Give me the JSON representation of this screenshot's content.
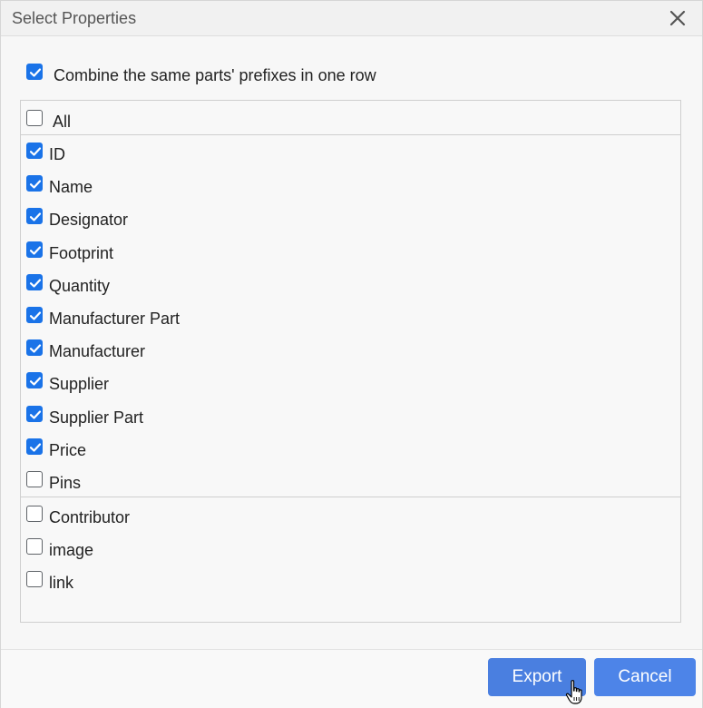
{
  "dialog": {
    "title": "Select Properties",
    "close_icon": "close-icon",
    "combine": {
      "label": "Combine the same parts' prefixes in one row",
      "checked": true
    },
    "all": {
      "label": "All",
      "checked": false
    },
    "group1": [
      {
        "key": "id",
        "label": "ID",
        "checked": true
      },
      {
        "key": "name",
        "label": "Name",
        "checked": true
      },
      {
        "key": "designator",
        "label": "Designator",
        "checked": true
      },
      {
        "key": "footprint",
        "label": "Footprint",
        "checked": true
      },
      {
        "key": "quantity",
        "label": "Quantity",
        "checked": true
      },
      {
        "key": "manufacturer-part",
        "label": "Manufacturer Part",
        "checked": true
      },
      {
        "key": "manufacturer",
        "label": "Manufacturer",
        "checked": true
      },
      {
        "key": "supplier",
        "label": "Supplier",
        "checked": true
      },
      {
        "key": "supplier-part",
        "label": "Supplier Part",
        "checked": true
      },
      {
        "key": "price",
        "label": "Price",
        "checked": true
      },
      {
        "key": "pins",
        "label": "Pins",
        "checked": false
      }
    ],
    "group2": [
      {
        "key": "contributor",
        "label": "Contributor",
        "checked": false
      },
      {
        "key": "image",
        "label": "image",
        "checked": false
      },
      {
        "key": "link",
        "label": "link",
        "checked": false
      }
    ],
    "buttons": {
      "export_label": "Export",
      "cancel_label": "Cancel"
    },
    "colors": {
      "checkbox_checked": "#1a73e8",
      "button_primary": "#4d84e8"
    },
    "cursor_icon": "hand-pointer-icon"
  }
}
